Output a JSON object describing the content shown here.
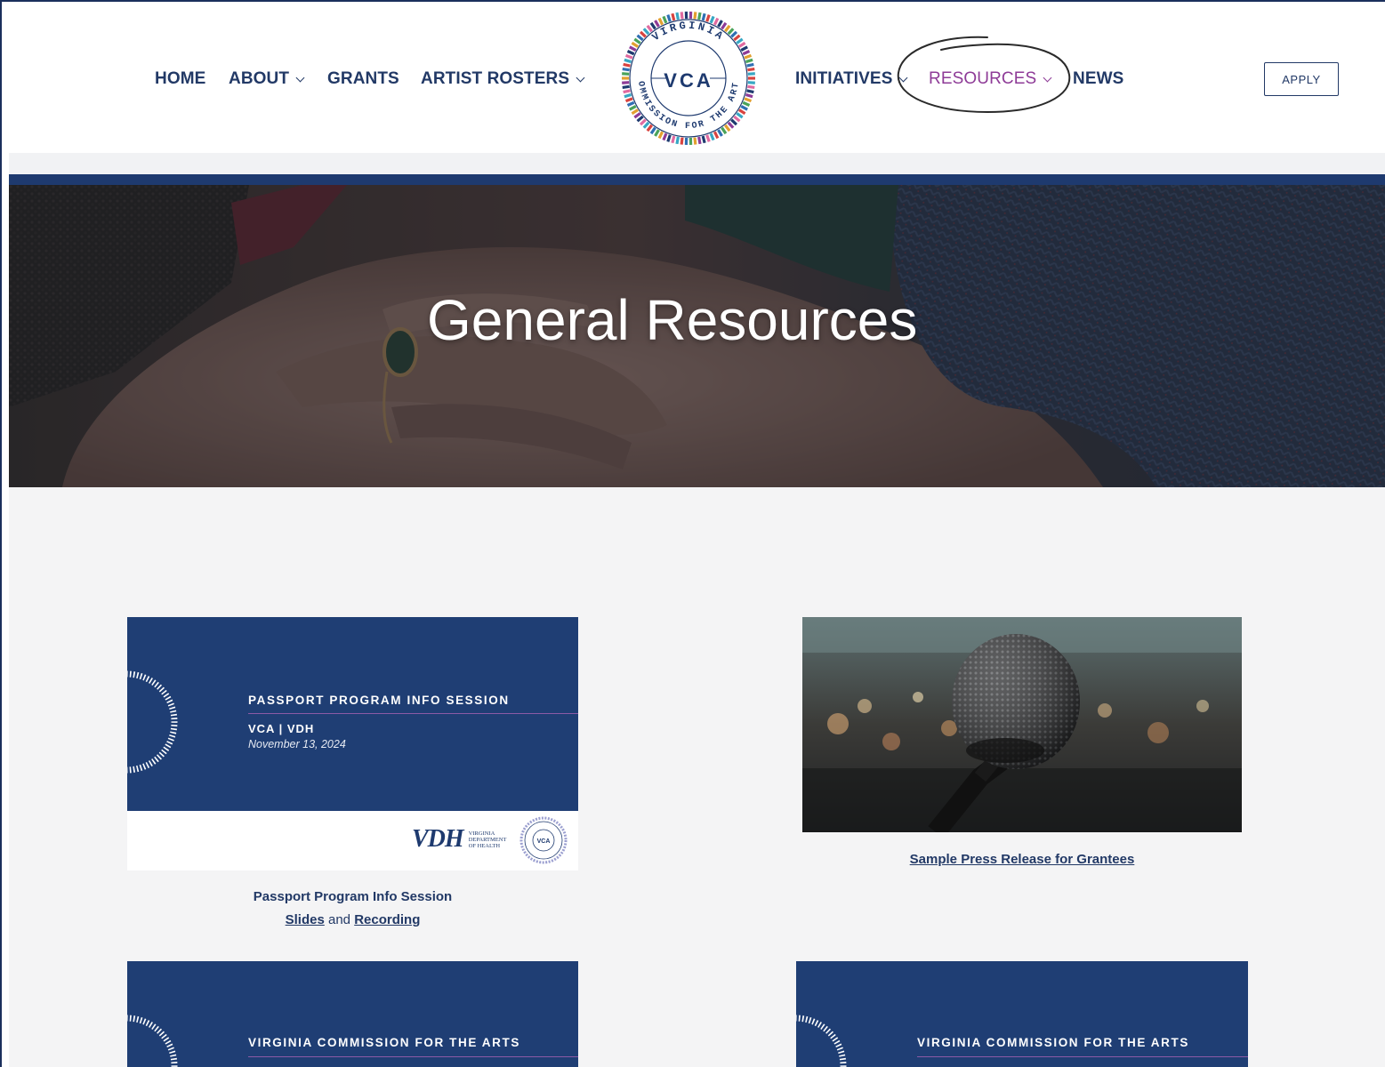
{
  "nav": {
    "left": [
      {
        "label": "HOME",
        "has_dropdown": false
      },
      {
        "label": "ABOUT",
        "has_dropdown": true
      },
      {
        "label": "GRANTS",
        "has_dropdown": false
      },
      {
        "label": "ARTIST ROSTERS",
        "has_dropdown": true
      }
    ],
    "right": [
      {
        "label": "INITIATIVES",
        "has_dropdown": true
      },
      {
        "label": "RESOURCES",
        "has_dropdown": true,
        "active": true
      },
      {
        "label": "NEWS",
        "has_dropdown": false
      }
    ],
    "apply_label": "APPLY",
    "logo": {
      "center_text": "VCA",
      "ring_text": "VIRGINIA COMMISSION FOR THE ARTS"
    }
  },
  "hero": {
    "title": "General Resources"
  },
  "cards": [
    {
      "slide_title": "PASSPORT PROGRAM INFO SESSION",
      "slide_sub": "VCA | VDH",
      "slide_date": "November 13, 2024",
      "vdh_logo_text": "VDH",
      "vdh_logo_sub": [
        "VIRGINIA",
        "DEPARTMENT",
        "OF HEALTH"
      ],
      "caption_line1": "Passport Program Info Session",
      "caption_link1": "Slides",
      "caption_and": "and",
      "caption_link2": "Recording"
    },
    {
      "image": "microphone-photo",
      "caption_link": "Sample Press Release for Grantees"
    },
    {
      "slide_title": "VIRGINIA COMMISSION FOR THE ARTS"
    },
    {
      "slide_title": "VIRGINIA COMMISSION FOR THE ARTS"
    }
  ],
  "colors": {
    "navy": "#1e3a6f",
    "nav_text": "#223966",
    "active_nav": "#8e3b97",
    "content_bg": "#f4f4f5"
  }
}
